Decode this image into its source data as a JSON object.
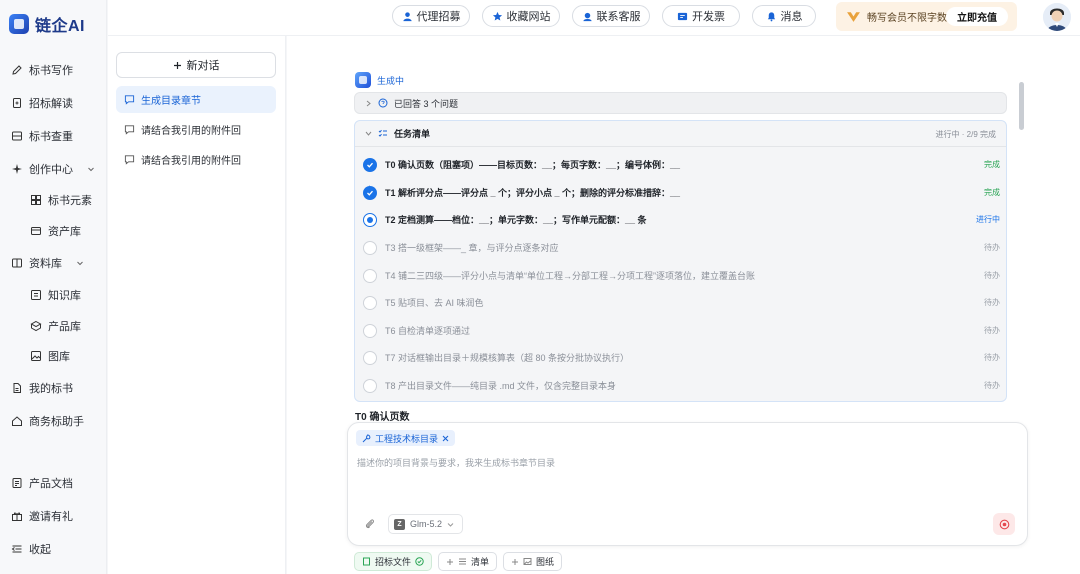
{
  "app": {
    "logo_text": "链企AI"
  },
  "sidebar": {
    "items": [
      {
        "label": "标书写作",
        "icon": "pen-icon"
      },
      {
        "label": "招标解读",
        "icon": "document-icon"
      },
      {
        "label": "标书查重",
        "icon": "stack-icon"
      },
      {
        "label": "创作中心",
        "icon": "sparkle-icon"
      },
      {
        "label": "标书元素",
        "icon": "grid-icon"
      },
      {
        "label": "资产库",
        "icon": "box-icon"
      },
      {
        "label": "资料库",
        "icon": "book-icon"
      },
      {
        "label": "知识库",
        "icon": "knowledge-icon"
      },
      {
        "label": "产品库",
        "icon": "cube-icon"
      },
      {
        "label": "图库",
        "icon": "image-icon"
      },
      {
        "label": "我的标书",
        "icon": "file-icon"
      },
      {
        "label": "商务标助手",
        "icon": "briefcase-icon"
      },
      {
        "label": "产品文档",
        "icon": "doc-icon"
      },
      {
        "label": "邀请有礼",
        "icon": "gift-icon"
      },
      {
        "label": "收起",
        "icon": "collapse-icon"
      }
    ]
  },
  "topbar": {
    "links": [
      {
        "label": "代理招募",
        "icon": "user-tie-icon"
      },
      {
        "label": "收藏网站",
        "icon": "star-icon"
      },
      {
        "label": "联系客服",
        "icon": "headset-icon"
      },
      {
        "label": "开发票",
        "icon": "invoice-icon"
      },
      {
        "label": "消息",
        "icon": "bell-icon"
      }
    ],
    "vip_text": "畅写会员不限字数",
    "vip_button": "立即充值"
  },
  "conversations": {
    "new_label": "新对话",
    "items": [
      {
        "label": "生成目录章节",
        "active": true
      },
      {
        "label": "请结合我引用的附件回"
      },
      {
        "label": "请结合我引用的附件回"
      }
    ]
  },
  "main": {
    "status": "生成中",
    "answered": "已回答 3 个问题",
    "tasks_title": "任务清单",
    "tasks_progress": "进行中 · 2/9 完成",
    "tasks": [
      {
        "text": "T0 确认页数（阻塞项）——目标页数：__；每页字数：__；编号体例：__",
        "status": "完成",
        "state": "done"
      },
      {
        "text": "T1 解析评分点——评分点 _ 个；评分小点 _ 个；删除的评分标准措辞：__",
        "status": "完成",
        "state": "done"
      },
      {
        "text": "T2 定档测算——档位：__；单元字数：__；写作单元配额：__ 条",
        "status": "进行中",
        "state": "active"
      },
      {
        "text": "T3 搭一级框架——_ 章，与评分点逐条对应",
        "status": "待办",
        "state": "todo"
      },
      {
        "text": "T4 铺二三四级——评分小点与清单“单位工程→分部工程→分项工程”逐项落位，建立覆盖台账",
        "status": "待办",
        "state": "todo"
      },
      {
        "text": "T5 贴项目、去 AI 味润色",
        "status": "待办",
        "state": "todo"
      },
      {
        "text": "T6 自检清单逐项通过",
        "status": "待办",
        "state": "todo"
      },
      {
        "text": "T7 对话框输出目录＋规模核算表（超 80 条按分批协议执行）",
        "status": "待办",
        "state": "todo"
      },
      {
        "text": "T8 产出目录文件——纯目录 .md 文件，仅含完整目录本身",
        "status": "待办",
        "state": "todo"
      }
    ],
    "section_title": "T0 确认页数"
  },
  "composer": {
    "tag": "工程技术标目录",
    "placeholder": "描述你的项目背景与要求，我来生成标书章节目录",
    "model": "Glm-5.2"
  },
  "chips": [
    {
      "label": "招标文件",
      "on": true
    },
    {
      "label": "清单"
    },
    {
      "label": "图纸"
    }
  ],
  "colors": {
    "accent": "#1a73e8",
    "done": "#2aa555",
    "vip_bg": "#fdf2e4"
  }
}
